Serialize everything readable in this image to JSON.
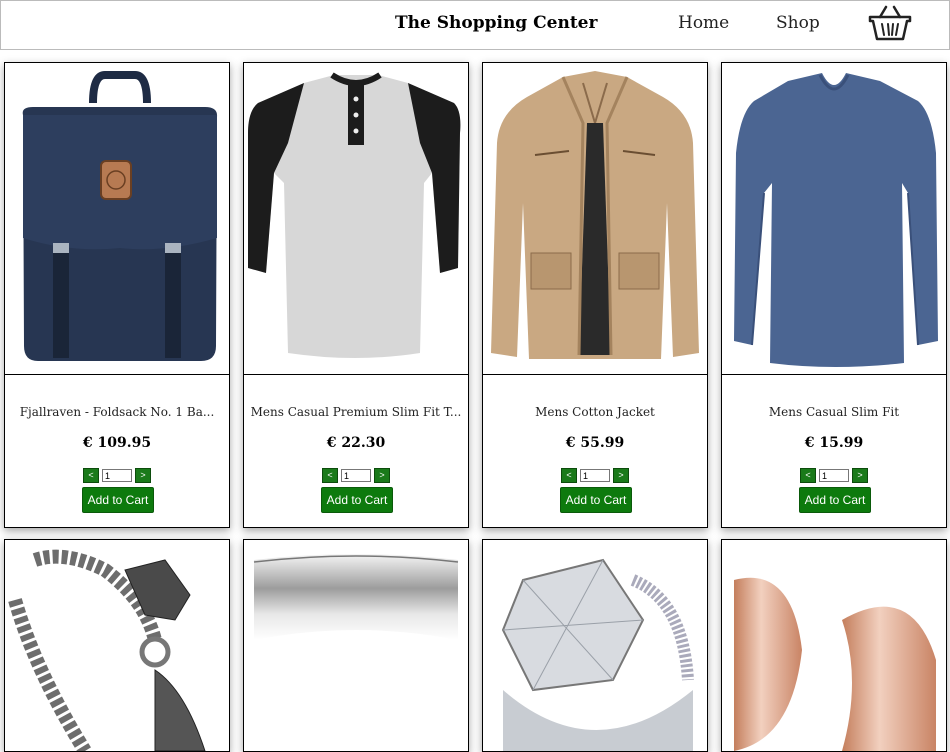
{
  "header": {
    "brand": "The Shopping Center",
    "nav": {
      "home": "Home",
      "shop": "Shop"
    }
  },
  "products": [
    {
      "title": "Fjallraven - Foldsack No. 1 Ba...",
      "price": "€ 109.95",
      "qty": "1",
      "prev": "<",
      "next": ">",
      "add": "Add to Cart"
    },
    {
      "title": "Mens Casual Premium Slim Fit T...",
      "price": "€ 22.30",
      "qty": "1",
      "prev": "<",
      "next": ">",
      "add": "Add to Cart"
    },
    {
      "title": "Mens Cotton Jacket",
      "price": "€ 55.99",
      "qty": "1",
      "prev": "<",
      "next": ">",
      "add": "Add to Cart"
    },
    {
      "title": "Mens Casual Slim Fit",
      "price": "€ 15.99",
      "qty": "1",
      "prev": "<",
      "next": ">",
      "add": "Add to Cart"
    }
  ],
  "colors": {
    "button_green": "#0d7a0d",
    "border": "#000000"
  }
}
